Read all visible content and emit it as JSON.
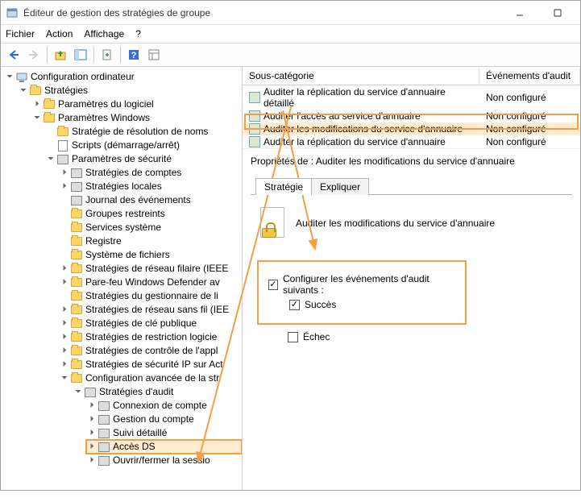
{
  "window": {
    "title": "Éditeur de gestion des stratégies de groupe"
  },
  "menu": {
    "file": "Fichier",
    "action": "Action",
    "view": "Affichage",
    "help": "?"
  },
  "tree": {
    "root": "Configuration ordinateur",
    "policies": "Stratégies",
    "params_logiciel": "Paramètres du logiciel",
    "params_windows": "Paramètres Windows",
    "strat_res_noms": "Stratégie de résolution de noms",
    "scripts": "Scripts (démarrage/arrêt)",
    "params_secu": "Paramètres de sécurité",
    "strat_comptes": "Stratégies de comptes",
    "strat_locales": "Stratégies locales",
    "journal": "Journal des événements",
    "groupes": "Groupes restreints",
    "services": "Services système",
    "registre": "Registre",
    "sysfichiers": "Système de fichiers",
    "reseau_fil": "Stratégies de réseau filaire (IEEE",
    "parefeu": "Pare-feu Windows Defender av",
    "gest_liste": "Stratégies du gestionnaire de li",
    "reseau_sans_fil": "Stratégies de réseau sans fil (IEE",
    "cle_publique": "Stratégies de clé publique",
    "restriction_log": "Stratégies de restriction logicie",
    "controle_appl": "Stratégies de contrôle de l'appl",
    "secu_ip": "Stratégies de sécurité IP sur Act",
    "config_avancee": "Configuration avancée de la str",
    "strat_audit": "Stratégies d'audit",
    "connexion_compte": "Connexion de compte",
    "gestion_compte": "Gestion du compte",
    "suivi_detail": "Suivi détaillé",
    "acces_ds": "Accès DS",
    "ouvrir_fermer": "Ouvrir/fermer la sessio"
  },
  "list": {
    "col_sub": "Sous-catégorie",
    "col_ev": "Événements d'audit",
    "rows": [
      {
        "label": "Auditer la réplication du service d'annuaire détaillé",
        "ev": "Non configuré"
      },
      {
        "label": "Auditer l'accès au service d'annuaire",
        "ev": "Non configuré"
      },
      {
        "label": "Auditer les modifications du service d'annuaire",
        "ev": "Non configuré"
      },
      {
        "label": "Auditer la réplication du service d'annuaire",
        "ev": "Non configuré"
      }
    ]
  },
  "props": {
    "title": "Propriétés de : Auditer les modifications du service d'annuaire",
    "tab_strategy": "Stratégie",
    "tab_explain": "Expliquer",
    "heading": "Auditer les modifications du service d'annuaire",
    "configure_label": "Configurer les événements d'audit suivants :",
    "success": "Succès",
    "failure": "Échec"
  }
}
